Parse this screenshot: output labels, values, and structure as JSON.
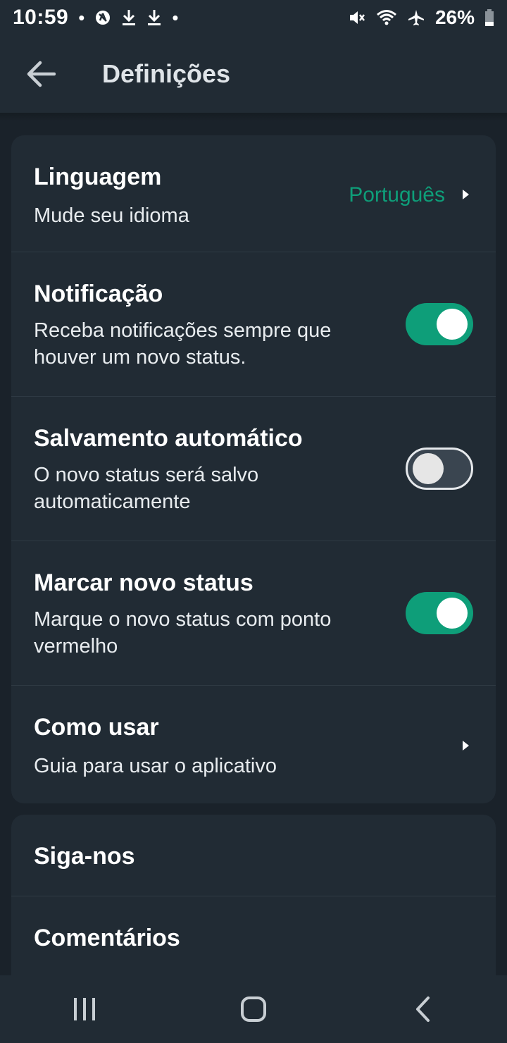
{
  "status_bar": {
    "time": "10:59",
    "battery": "26%",
    "left_icons": [
      "dot",
      "vpn-icon",
      "download-icon",
      "download-icon",
      "dot"
    ],
    "right_icons": [
      "mute-icon",
      "wifi-icon",
      "airplane-icon",
      "battery-icon"
    ]
  },
  "app_bar": {
    "back_icon": "arrow-left-icon",
    "title": "Definições"
  },
  "settings": {
    "language": {
      "title": "Linguagem",
      "subtitle": "Mude seu idioma",
      "value": "Português"
    },
    "notification": {
      "title": "Notificação",
      "subtitle": "Receba notificações sempre que houver um novo status.",
      "enabled": true
    },
    "autosave": {
      "title": "Salvamento automático",
      "subtitle": "O novo status será salvo automaticamente",
      "enabled": false
    },
    "mark_status": {
      "title": "Marcar novo status",
      "subtitle": "Marque o novo status com ponto vermelho",
      "enabled": true
    },
    "how_to_use": {
      "title": "Como usar",
      "subtitle": "Guia para usar o aplicativo"
    }
  },
  "extra": {
    "follow_us": "Siga-nos",
    "comments": "Comentários"
  },
  "nav_bar": {
    "icons": [
      "recents-icon",
      "home-icon",
      "back-icon"
    ]
  },
  "colors": {
    "background": "#1a222a",
    "surface": "#212b34",
    "accent": "#0e9e79",
    "text": "#ffffff"
  }
}
